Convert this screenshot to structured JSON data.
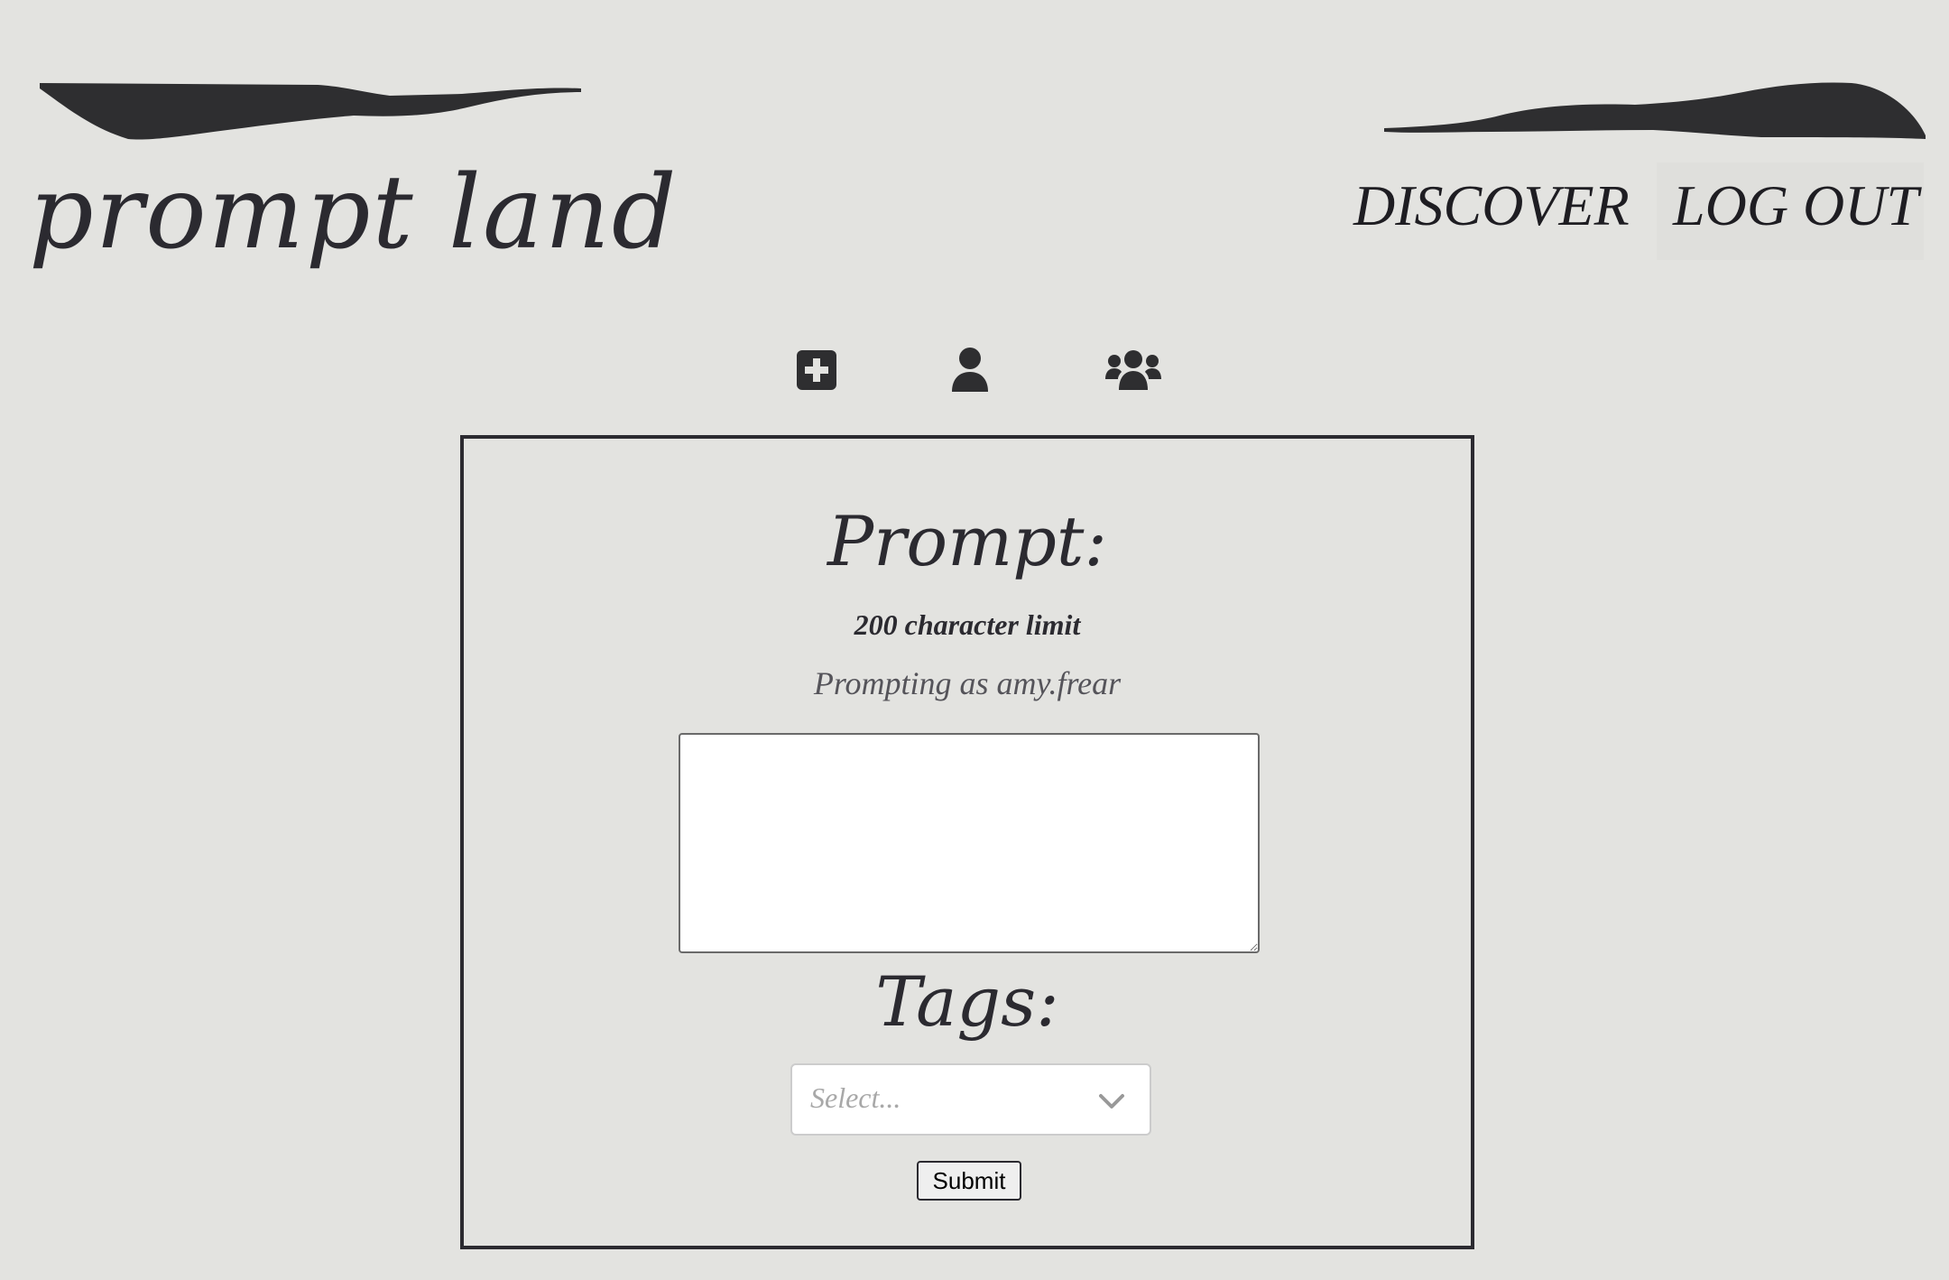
{
  "header": {
    "logo_text": "prompt land",
    "nav": {
      "discover_label": "DISCOVER",
      "logout_label": "LOG OUT"
    }
  },
  "toolbar": {
    "icons": [
      "plus-square-icon",
      "user-icon",
      "users-icon"
    ]
  },
  "form": {
    "prompt_heading": "Prompt:",
    "limit_text": "200 character limit",
    "prompting_as": "Prompting as amy.frear",
    "prompt_value": "",
    "tags_heading": "Tags:",
    "tags_placeholder": "Select...",
    "submit_label": "Submit"
  },
  "colors": {
    "background": "#e3e3e0",
    "ink": "#2b2a30",
    "panel_border": "#2b2a30"
  }
}
